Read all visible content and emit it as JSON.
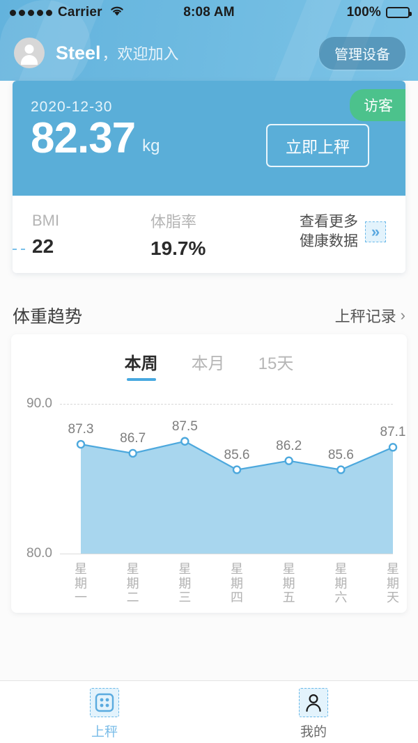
{
  "status_bar": {
    "carrier": "Carrier",
    "signal_dots": 5,
    "wifi_icon": "wifi-icon",
    "time": "8:08 AM",
    "battery_percent": "100%",
    "battery_icon": "battery-full-icon"
  },
  "header": {
    "avatar_icon": "user-avatar-icon",
    "user_name": "Steel",
    "welcome_text": "，欢迎加入",
    "manage_button": "管理设备",
    "background_color": "#6cb9e0"
  },
  "weight_card": {
    "date": "2020-12-30",
    "weight": "82.37",
    "unit": "kg",
    "guest_badge": "访客",
    "guest_badge_color": "#4cc28c",
    "weigh_now_button": "立即上秤",
    "card_color": "#5aaed8",
    "stats": [
      {
        "label": "BMI",
        "value": "22"
      },
      {
        "label": "体脂率",
        "value": "19.7%"
      }
    ],
    "more_link_line1": "查看更多",
    "more_link_line2": "健康数据",
    "more_icon": "double-chevron-right-icon"
  },
  "trend": {
    "title": "体重趋势",
    "record_link": "上秤记录",
    "record_chevron_icon": "chevron-right-icon",
    "tabs": [
      {
        "label": "本周",
        "active": true
      },
      {
        "label": "本月",
        "active": false
      },
      {
        "label": "15天",
        "active": false
      }
    ]
  },
  "chart_data": {
    "type": "area",
    "title": "体重趋势",
    "categories": [
      "星期一",
      "星期二",
      "星期三",
      "星期四",
      "星期五",
      "星期六",
      "星期天"
    ],
    "values": [
      87.3,
      86.7,
      87.5,
      85.6,
      86.2,
      85.6,
      87.1
    ],
    "point_labels": [
      "87.3",
      "86.7",
      "87.5",
      "85.6",
      "86.2",
      "85.6",
      "87.1"
    ],
    "ylim": [
      80.0,
      90.0
    ],
    "ytick_labels": [
      "90.0",
      "80.0"
    ],
    "xlabel": "",
    "ylabel": "",
    "grid": true,
    "legend": "none",
    "line_color": "#4ca8dd",
    "fill_color": "#a8d6ee",
    "point_fill": "#ffffff",
    "unit": "kg"
  },
  "tabbar": {
    "items": [
      {
        "label": "上秤",
        "icon": "scale-icon",
        "active": true
      },
      {
        "label": "我的",
        "icon": "person-icon",
        "active": false
      }
    ]
  }
}
